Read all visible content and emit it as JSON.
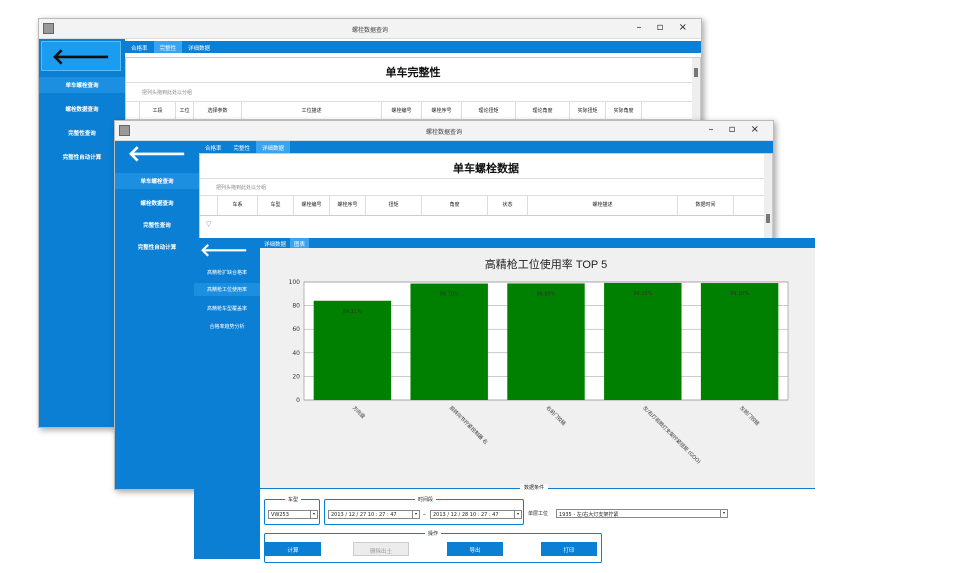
{
  "back_icon": "arrow-left-icon",
  "window1": {
    "title": "螺栓数据查询",
    "controls": "– ▫ ×",
    "tabs": [
      "合格率",
      "完整性",
      "详细数据"
    ],
    "nav": [
      "单车螺栓查询",
      "螺栓数据查询",
      "完整性查询",
      "完整性自动计算"
    ],
    "panel_title": "单车完整性",
    "filter_hint": "把列头拖到此处以分组",
    "columns": [
      "工段",
      "工位",
      "选择参数",
      "工位描述",
      "螺栓编号",
      "螺栓序号",
      "理论扭矩",
      "理论角度",
      "实际扭矩",
      "实际角度"
    ]
  },
  "window2": {
    "title": "螺栓数据查询",
    "controls": "– ▫ ×",
    "tabs": [
      "合格率",
      "完整性",
      "详细数据"
    ],
    "nav": [
      "单车螺栓查询",
      "螺栓数据查询",
      "完整性查询",
      "完整性自动计算"
    ],
    "panel_title": "单车螺栓数据",
    "filter_hint": "把列头拖到此处以分组",
    "columns": [
      "车系",
      "车型",
      "螺栓编号",
      "螺栓序号",
      "扭矩",
      "角度",
      "状态",
      "螺栓描述",
      "数据时间"
    ]
  },
  "window3": {
    "tabs": [
      "详细数据",
      "图表"
    ],
    "nav": [
      "高精枪扩缺合格率",
      "高精枪工位使用率",
      "高精枪车型覆盖率",
      "合格率趋势分析"
    ],
    "conditions_label": "数据条件",
    "vehicle_group": "车型",
    "vehicle_value": "VW253",
    "period_group": "时间段",
    "start_time": "2013 / 12 / 27    10 : 27 : 47",
    "separator": "–",
    "end_time": "2013 / 12 / 28    10 : 27 : 47",
    "station_label": "单层工位",
    "station_value": "1935 - 左/右大灯支架拧紧",
    "ops_group": "操作",
    "buttons": [
      "计算",
      "删除出土",
      "导出",
      "打印"
    ]
  },
  "chart_data": {
    "type": "bar",
    "title": "高精枪工位使用率 TOP 5",
    "categories": [
      "方向盘",
      "前转向节拧紧控制器 右",
      "右前门铰链",
      "左/右灯前照灯支架拧紧扭矩 (GOO)",
      "左前门铰链"
    ],
    "values": [
      84.11,
      98.7,
      98.8,
      99.2,
      99.1
    ],
    "data_labels": [
      "84.11%",
      "98.70%",
      "98.80%",
      "99.20%",
      "99.10%"
    ],
    "ylim": [
      0,
      100
    ],
    "yticks": [
      0,
      20,
      40,
      60,
      80,
      100
    ],
    "grid": true,
    "color": "#008000"
  }
}
